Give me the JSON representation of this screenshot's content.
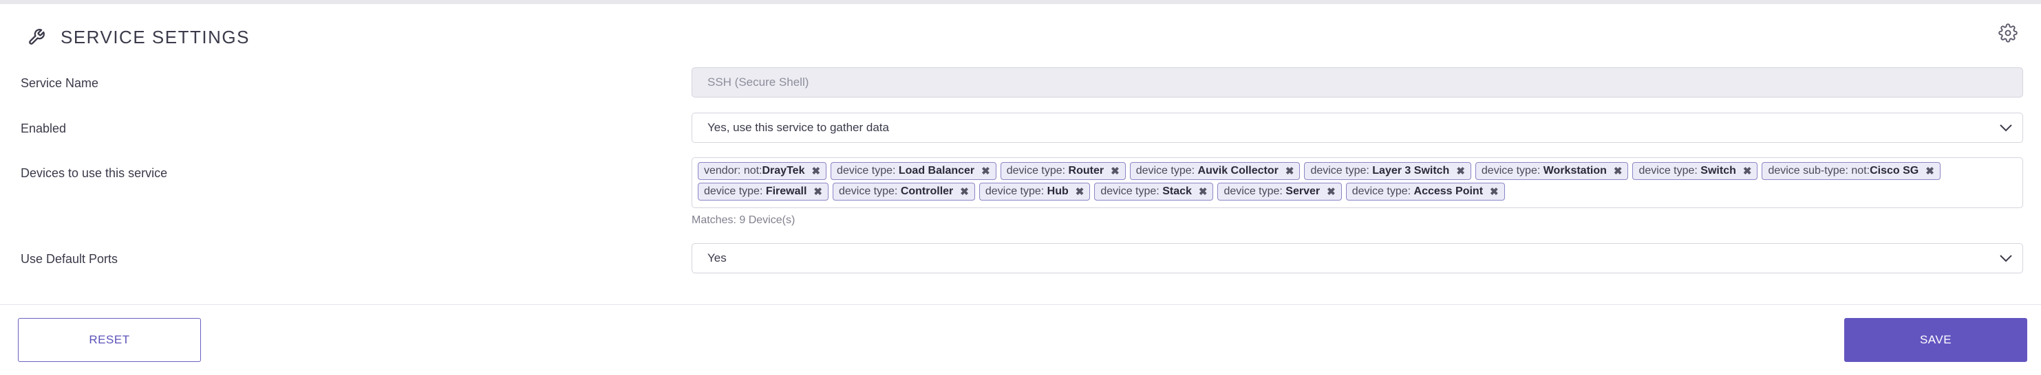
{
  "header": {
    "title": "SERVICE SETTINGS",
    "icon": "wrench-icon",
    "action_icon": "gear-icon"
  },
  "fields": {
    "service_name": {
      "label": "Service Name",
      "value": "SSH (Secure Shell)"
    },
    "enabled": {
      "label": "Enabled",
      "value": "Yes, use this service to gather data"
    },
    "devices": {
      "label": "Devices to use this service",
      "tags": [
        {
          "prefix": "vendor: not:",
          "value": "DrayTek"
        },
        {
          "prefix": "device type: ",
          "value": "Load Balancer"
        },
        {
          "prefix": "device type: ",
          "value": "Router"
        },
        {
          "prefix": "device type: ",
          "value": "Auvik Collector"
        },
        {
          "prefix": "device type: ",
          "value": "Layer 3 Switch"
        },
        {
          "prefix": "device type: ",
          "value": "Workstation"
        },
        {
          "prefix": "device type: ",
          "value": "Switch"
        },
        {
          "prefix": "device sub-type: not:",
          "value": "Cisco SG"
        },
        {
          "prefix": "device type: ",
          "value": "Firewall"
        },
        {
          "prefix": "device type: ",
          "value": "Controller"
        },
        {
          "prefix": "device type: ",
          "value": "Hub"
        },
        {
          "prefix": "device type: ",
          "value": "Stack"
        },
        {
          "prefix": "device type: ",
          "value": "Server"
        },
        {
          "prefix": "device type: ",
          "value": "Access Point"
        }
      ],
      "matches": "Matches: 9 Device(s)"
    },
    "default_ports": {
      "label": "Use Default Ports",
      "value": "Yes"
    }
  },
  "buttons": {
    "reset": "RESET",
    "save": "SAVE"
  },
  "colors": {
    "accent": "#6355c0",
    "tag_border": "#8b86c7",
    "tag_bg": "#ebeaf7"
  }
}
